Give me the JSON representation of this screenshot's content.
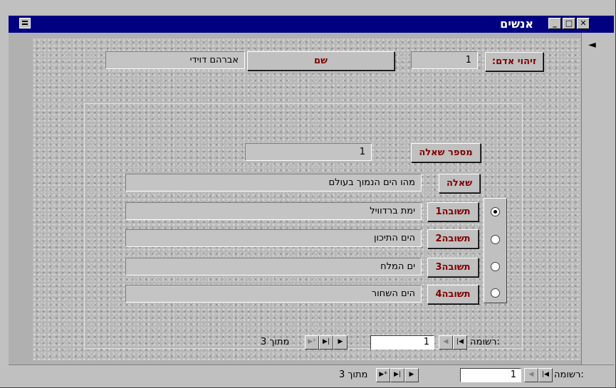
{
  "window": {
    "title": "אנשים",
    "min_label": "_",
    "max_label": "□",
    "close_label": "✕"
  },
  "record_selector": "◄",
  "person": {
    "id_label": "זיהוי אדם:",
    "id_value": "1",
    "name_label": "שם",
    "name_value": "אברהם דוידי"
  },
  "question": {
    "number_label": "מספר שאלה",
    "number_value": "1",
    "question_label": "שאלה",
    "question_value": "מהו הים הנמוך בעולם",
    "answers": [
      {
        "label": "תשובה1",
        "value": "ימת ברדוויל",
        "selected": true
      },
      {
        "label": "תשובה2",
        "value": "הים התיכון",
        "selected": false
      },
      {
        "label": "תשובה3",
        "value": "ים המלח",
        "selected": false
      },
      {
        "label": "תשובה4",
        "value": "הים השחור",
        "selected": false
      }
    ]
  },
  "subform_nav": {
    "record_label": "רשומה:",
    "current": "1",
    "of_text": "מתוך 3"
  },
  "main_nav": {
    "record_label": "רשומה:",
    "current": "1",
    "of_text": "מתוך 3"
  },
  "colors": {
    "titlebar": "#000080",
    "label_text": "#800000",
    "face": "#c0c0c0"
  }
}
